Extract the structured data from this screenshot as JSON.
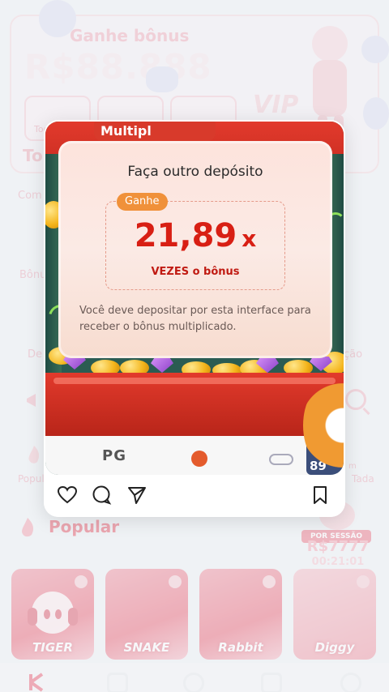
{
  "background": {
    "bonus_title": "Ganhe bônus",
    "bonus_amount": "R$88.888",
    "vip_text": "VIP",
    "tiles": [
      {
        "label": "Tod"
      },
      {
        "label": ""
      },
      {
        "label": ""
      }
    ],
    "left_labels": [
      {
        "text": "To",
        "big": true
      },
      {
        "text": "Com"
      },
      {
        "text": "Bônus"
      },
      {
        "text": "De"
      },
      {
        "text": "Popul"
      }
    ],
    "right_labels": [
      {
        "text": "ção"
      },
      {
        "text": "Tada"
      }
    ],
    "score_tag": "m"
  },
  "popular": {
    "title": "Popular",
    "promo": {
      "label": "POR SESSÃO",
      "amount": "R$7777",
      "timer": "00:21:01"
    },
    "games": [
      {
        "name": "TIGER"
      },
      {
        "name": "SNAKE"
      },
      {
        "name": "Rabbit"
      },
      {
        "name": "Diggy"
      }
    ]
  },
  "modal": {
    "banner_text": "Multipl",
    "title": "Faça outro depósito",
    "tag": "Ganhe",
    "multiplier_value": "21,89",
    "multiplier_suffix": "x",
    "times_text": "VEZES o bônus",
    "description": "Você deve depositar por esta interface para receber o bônus multiplicado.",
    "strip": {
      "pg_logo": "PG",
      "score": "89"
    }
  },
  "actions": {
    "icons": [
      "heart-icon",
      "comment-icon",
      "send-icon",
      "bookmark-icon"
    ]
  },
  "colors": {
    "accent_red": "#d81f14",
    "tag_orange": "#f0913a",
    "popular_red": "#e54a5c"
  }
}
